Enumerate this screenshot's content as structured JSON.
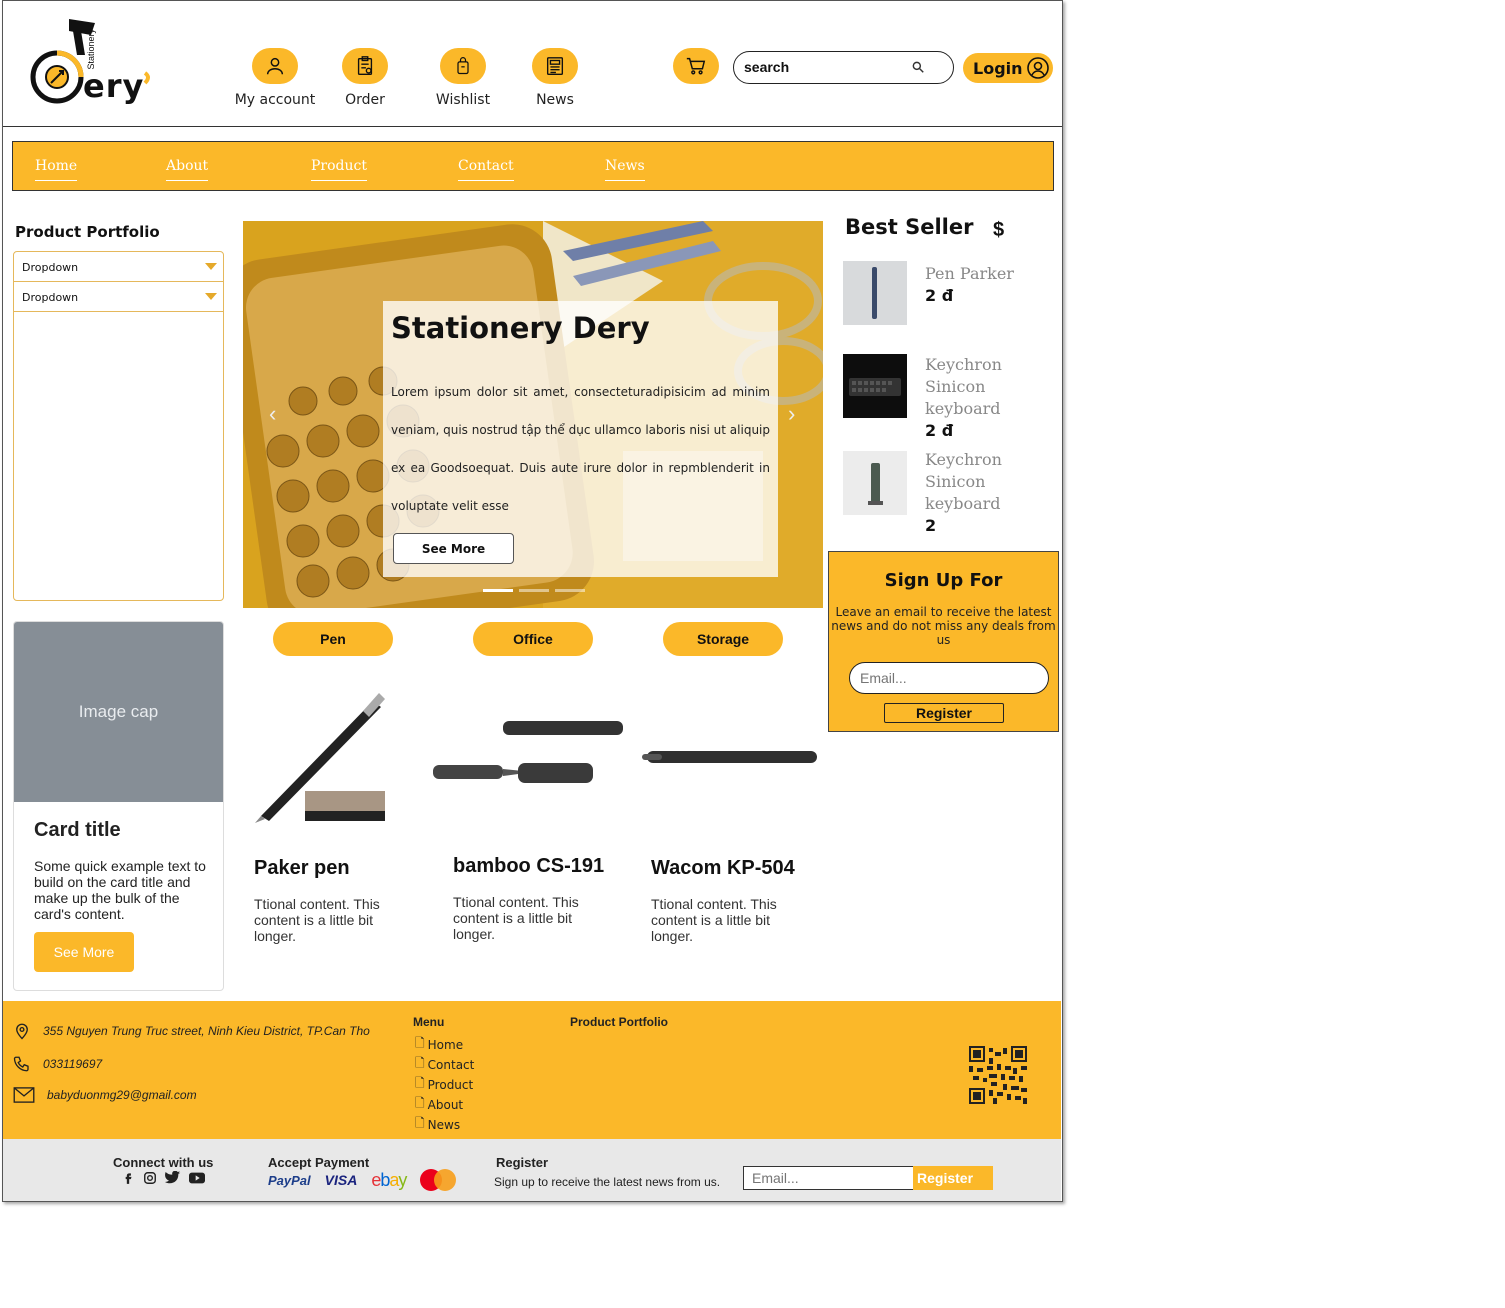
{
  "brand": {
    "name_main": "ery",
    "name_tag": "Stationery",
    "logo_letter_c": "C",
    "logo_letter_d": "D"
  },
  "top_nav": [
    {
      "label": "My account",
      "icon": "user-icon"
    },
    {
      "label": "Order",
      "icon": "clipboard-icon"
    },
    {
      "label": "Wishlist",
      "icon": "bag-icon"
    },
    {
      "label": "News",
      "icon": "newspaper-icon"
    }
  ],
  "search": {
    "placeholder": "search"
  },
  "login": {
    "label": "Login"
  },
  "navbar": [
    "Home",
    "About",
    "Product",
    "Contact",
    "News"
  ],
  "sidebar": {
    "title": "Product Portfolio",
    "dropdowns": [
      "Dropdown",
      "Dropdown"
    ]
  },
  "card": {
    "image_cap": "Image cap",
    "title": "Card title",
    "text": "Some quick example text to build on the card title and make up the bulk of the card's content.",
    "button": "See More"
  },
  "hero": {
    "title": "Stationery Dery",
    "text": "Lorem ipsum dolor sit amet, consecteturadipisicim ad minim veniam, quis nostrud tập thể dục ullamco laboris nisi ut aliquip ex ea Goodsoequat. Duis aute irure dolor in repmblenderit in voluptate velit esse",
    "button": "See More"
  },
  "categories": [
    "Pen",
    "Office",
    "Storage"
  ],
  "products": [
    {
      "title": "Paker pen",
      "text": "Ttional content. This content is a little bit longer."
    },
    {
      "title": "bamboo CS-191",
      "text": "Ttional content. This content is a little bit longer."
    },
    {
      "title": "Wacom KP-504",
      "text": "Ttional content. This content is a little bit longer."
    }
  ],
  "best_seller": {
    "title": "Best Seller",
    "currency": "$",
    "items": [
      {
        "name": "Pen Parker",
        "price": "2 đ"
      },
      {
        "name": "Keychron Sinicon keyboard",
        "price": "2 đ"
      },
      {
        "name": "Keychron Sinicon keyboard",
        "price": "2"
      }
    ]
  },
  "signup": {
    "title": "Sign Up For",
    "text": "Leave an email to receive the latest news and do not miss any deals from us",
    "placeholder": "Email...",
    "button": "Register"
  },
  "footer": {
    "address": "355 Nguyen Trung Truc street, Ninh Kieu District, TP.Can Tho",
    "phone": "033119697",
    "email": "babyduonmg29@gmail.com",
    "menu_title": "Menu",
    "menu": [
      "Home",
      "Contact",
      "Product",
      "About",
      "News"
    ],
    "portfolio_title": "Product Portfolio"
  },
  "bottom": {
    "connect": "Connect with us",
    "payment": "Accept Payment",
    "register_title": "Register",
    "register_text": "Sign up to receive the latest news from us.",
    "placeholder": "Email...",
    "button": "Register",
    "payment_logos": [
      "PayPal",
      "VISA",
      "ebay",
      "MasterCard"
    ]
  },
  "colors": {
    "accent": "#fbb829",
    "footer_bottom": "#e8e8e8",
    "card_cap": "#868e96"
  }
}
